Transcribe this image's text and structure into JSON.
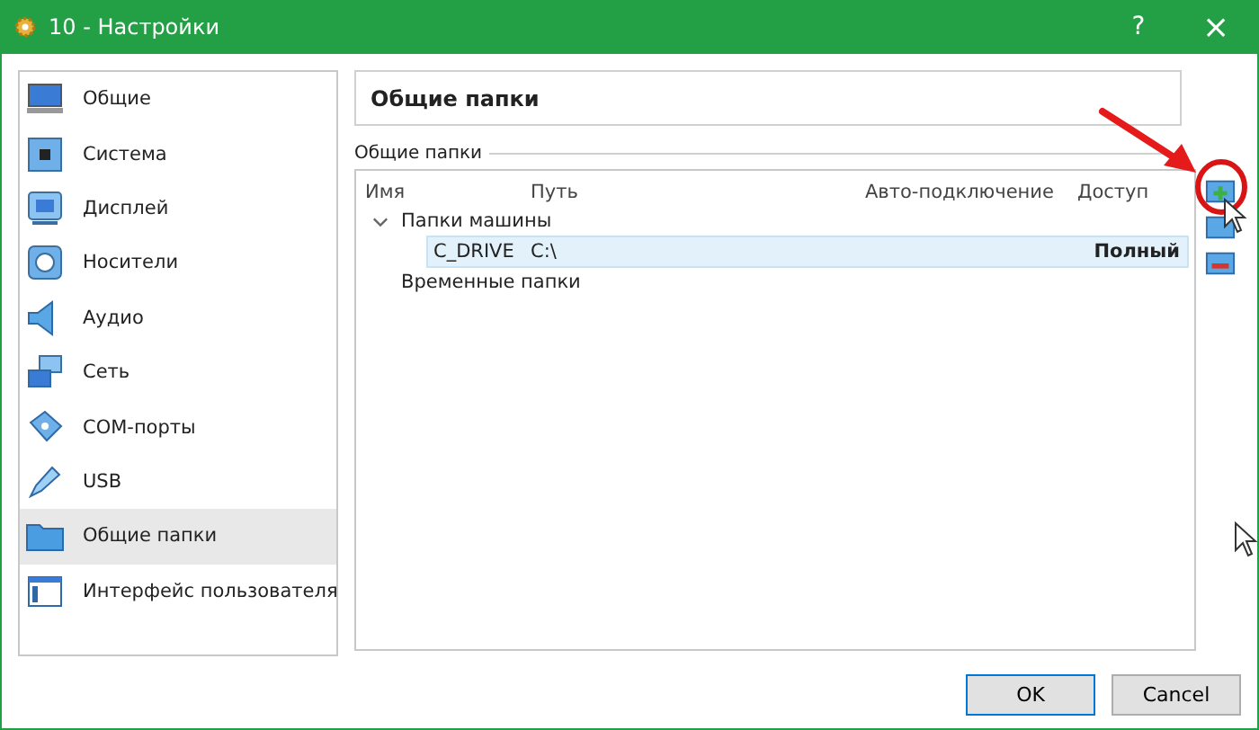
{
  "window": {
    "title": "10 - Настройки",
    "help": "?",
    "close": "×"
  },
  "sidebar": {
    "items": [
      {
        "label": "Общие",
        "selected": false
      },
      {
        "label": "Система",
        "selected": false
      },
      {
        "label": "Дисплей",
        "selected": false
      },
      {
        "label": "Носители",
        "selected": false
      },
      {
        "label": "Аудио",
        "selected": false
      },
      {
        "label": "Сеть",
        "selected": false
      },
      {
        "label": "COM-порты",
        "selected": false
      },
      {
        "label": "USB",
        "selected": false
      },
      {
        "label": "Общие папки",
        "selected": true
      },
      {
        "label": "Интерфейс пользователя",
        "selected": false
      }
    ]
  },
  "page_title": "Общие папки",
  "group_label": "Общие папки",
  "table": {
    "columns": [
      "Имя",
      "Путь",
      "Авто-подключение",
      "Доступ"
    ],
    "rows": [
      {
        "name": "Папки машины",
        "expanded": true,
        "children": [
          {
            "name": "C_DRIVE",
            "path": "C:\\",
            "access": "Полный",
            "selected": true
          }
        ]
      },
      {
        "name": "Временные папки",
        "expanded": false,
        "children": []
      }
    ]
  },
  "buttons": [
    "OK",
    "Cancel"
  ]
}
